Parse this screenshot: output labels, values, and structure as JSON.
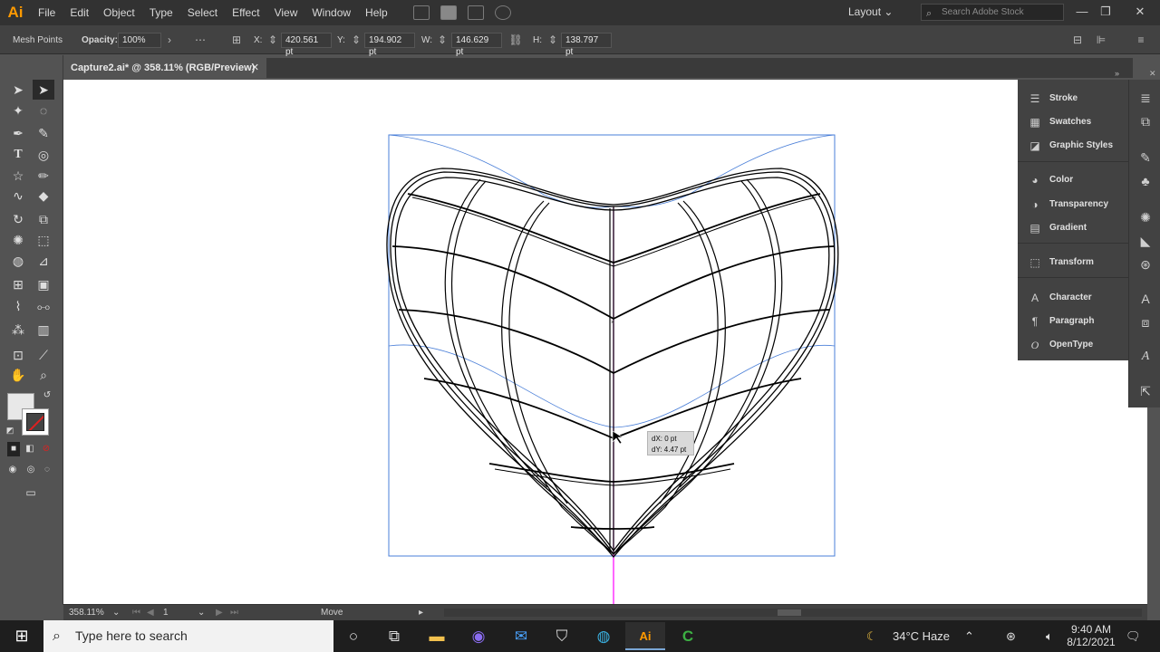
{
  "app": {
    "logo": "Ai"
  },
  "menu": {
    "items": [
      "File",
      "Edit",
      "Object",
      "Type",
      "Select",
      "Effect",
      "View",
      "Window",
      "Help"
    ]
  },
  "workspace": {
    "layout": "Layout"
  },
  "stock_search": {
    "placeholder": "Search Adobe Stock"
  },
  "control_bar": {
    "mode": "Mesh Points",
    "opacity_label": "Opacity:",
    "opacity_value": "100%",
    "x_label": "X:",
    "x_value": "420.561 pt",
    "y_label": "Y:",
    "y_value": "194.902 pt",
    "w_label": "W:",
    "w_value": "146.629 pt",
    "h_label": "H:",
    "h_value": "138.797 pt"
  },
  "document": {
    "tab_title": "Capture2.ai* @ 358.11% (RGB/Preview)"
  },
  "drag_tooltip": {
    "dx": "dX: 0 pt",
    "dy": "dY: 4.47 pt"
  },
  "panels": [
    {
      "icon": "stroke-icon",
      "label": "Stroke"
    },
    {
      "icon": "swatches-icon",
      "label": "Swatches"
    },
    {
      "icon": "graphic-styles-icon",
      "label": "Graphic Styles"
    },
    {
      "icon": "color-icon",
      "label": "Color"
    },
    {
      "icon": "transparency-icon",
      "label": "Transparency"
    },
    {
      "icon": "gradient-icon",
      "label": "Gradient"
    },
    {
      "icon": "transform-icon",
      "label": "Transform"
    },
    {
      "icon": "character-icon",
      "label": "Character"
    },
    {
      "icon": "paragraph-icon",
      "label": "Paragraph"
    },
    {
      "icon": "opentype-icon",
      "label": "OpenType"
    }
  ],
  "status_bar": {
    "zoom": "358.11%",
    "artboard": "1",
    "tool": "Move"
  },
  "taskbar": {
    "search_placeholder": "Type here to search",
    "weather": "34°C  Haze",
    "time": "9:40 AM",
    "date": "8/12/2021"
  },
  "colors": {
    "accent": "#ff9a00",
    "guide": "#ff00ff",
    "bbox": "#4a7fd8"
  }
}
